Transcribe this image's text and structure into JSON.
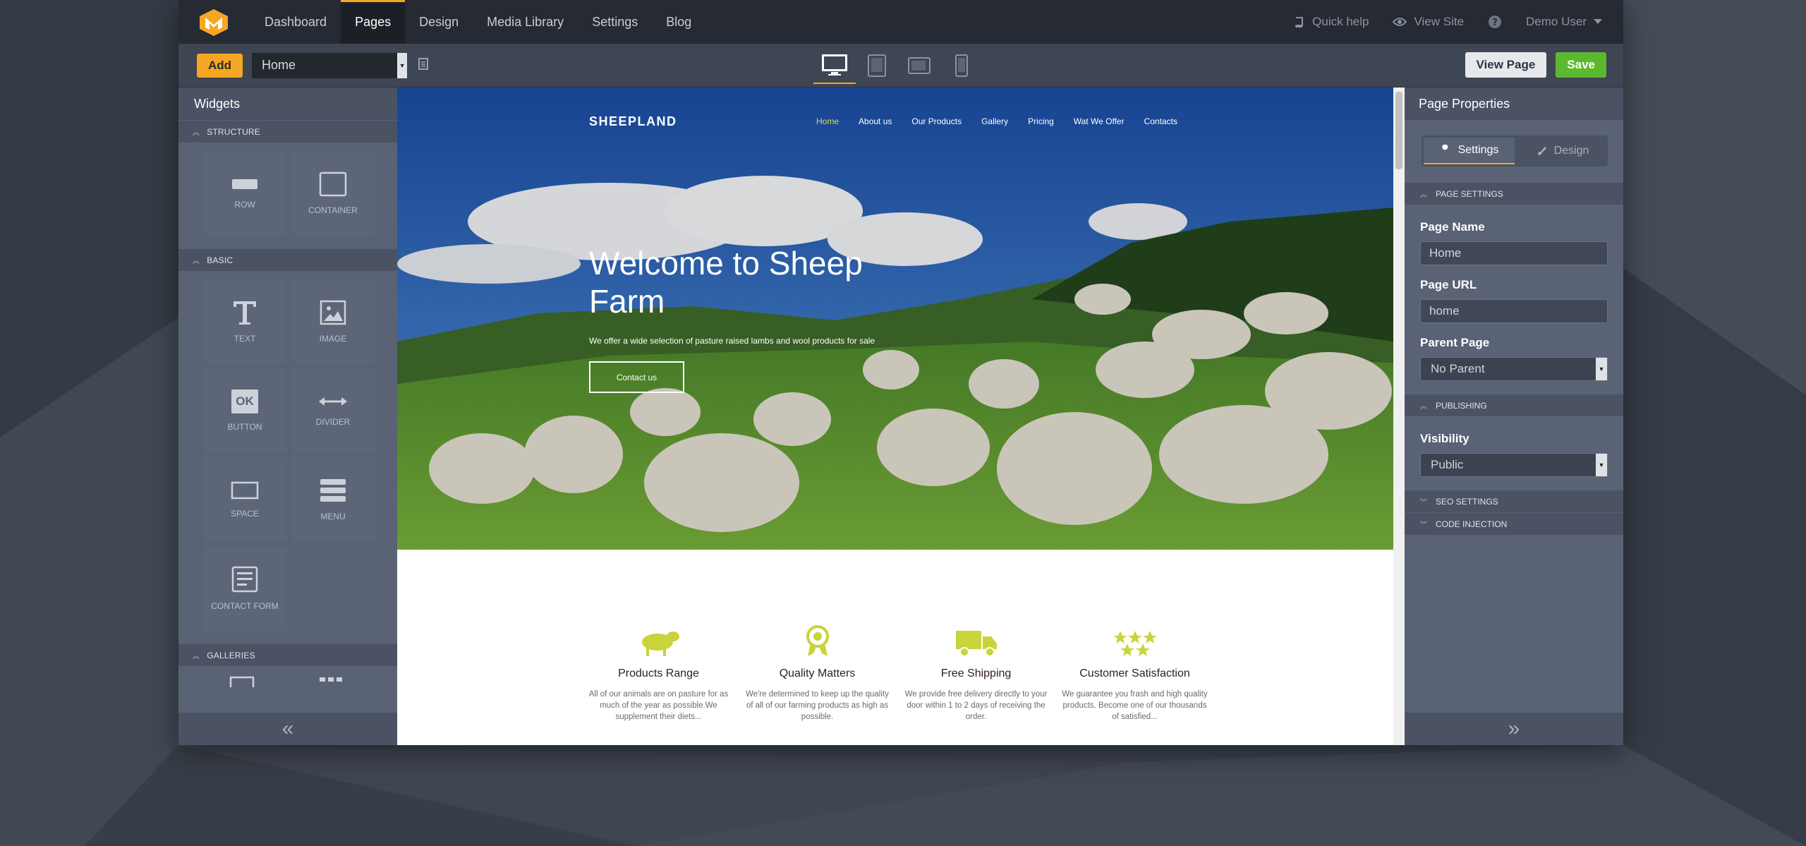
{
  "colors": {
    "accent": "#f5a623",
    "save": "#5cb82e",
    "site_accent": "#c8d43a"
  },
  "topbar": {
    "nav": [
      "Dashboard",
      "Pages",
      "Design",
      "Media Library",
      "Settings",
      "Blog"
    ],
    "active_nav": "Pages",
    "quick_help": "Quick help",
    "view_site": "View Site",
    "user": "Demo User"
  },
  "toolbar": {
    "add_label": "Add",
    "page_select_value": "Home",
    "view_page_label": "View Page",
    "save_label": "Save",
    "devices": [
      "desktop-icon",
      "tablet-icon",
      "tablet-landscape-icon",
      "phone-icon"
    ]
  },
  "widgets": {
    "title": "Widgets",
    "sections": {
      "structure": "STRUCTURE",
      "basic": "BASIC",
      "galleries": "GALLERIES"
    },
    "items": {
      "row": "ROW",
      "container": "CONTAINER",
      "text": "TEXT",
      "image": "IMAGE",
      "button": "BUTTON",
      "button_glyph": "OK",
      "divider": "DIVIDER",
      "space": "SPACE",
      "menu": "MENU",
      "contact_form": "CONTACT FORM"
    }
  },
  "site": {
    "logo": "SHEEPLAND",
    "nav": [
      "Home",
      "About us",
      "Our Products",
      "Gallery",
      "Pricing",
      "Wat We Offer",
      "Contacts"
    ],
    "hero_title": "Welcome to Sheep Farm",
    "hero_sub": "We offer a wide selection of pasture raised lambs and wool products for sale",
    "hero_button": "Contact us",
    "features": [
      {
        "icon": "sheep-icon",
        "title": "Products Range",
        "desc": "All of our animals are on pasture for as much of the year as possible.We supplement their diets..."
      },
      {
        "icon": "award-icon",
        "title": "Quality Matters",
        "desc": "We're determined to keep up the quality of all of our farming products as high as possible."
      },
      {
        "icon": "truck-icon",
        "title": "Free Shipping",
        "desc": "We provide free delivery directly to your door within 1 to 2 days of receiving the order."
      },
      {
        "icon": "stars-icon",
        "title": "Customer Satisfaction",
        "desc": "We guarantee you frash and high quality products. Become one of our thousands of satisfied..."
      }
    ]
  },
  "properties": {
    "title": "Page Properties",
    "tab_settings": "Settings",
    "tab_design": "Design",
    "page_settings_head": "PAGE SETTINGS",
    "page_name_label": "Page Name",
    "page_name_value": "Home",
    "page_url_label": "Page URL",
    "page_url_value": "home",
    "parent_page_label": "Parent Page",
    "parent_page_value": "No Parent",
    "publishing_head": "PUBLISHING",
    "visibility_label": "Visibility",
    "visibility_value": "Public",
    "seo_head": "SEO SETTINGS",
    "code_head": "CODE INJECTION"
  }
}
